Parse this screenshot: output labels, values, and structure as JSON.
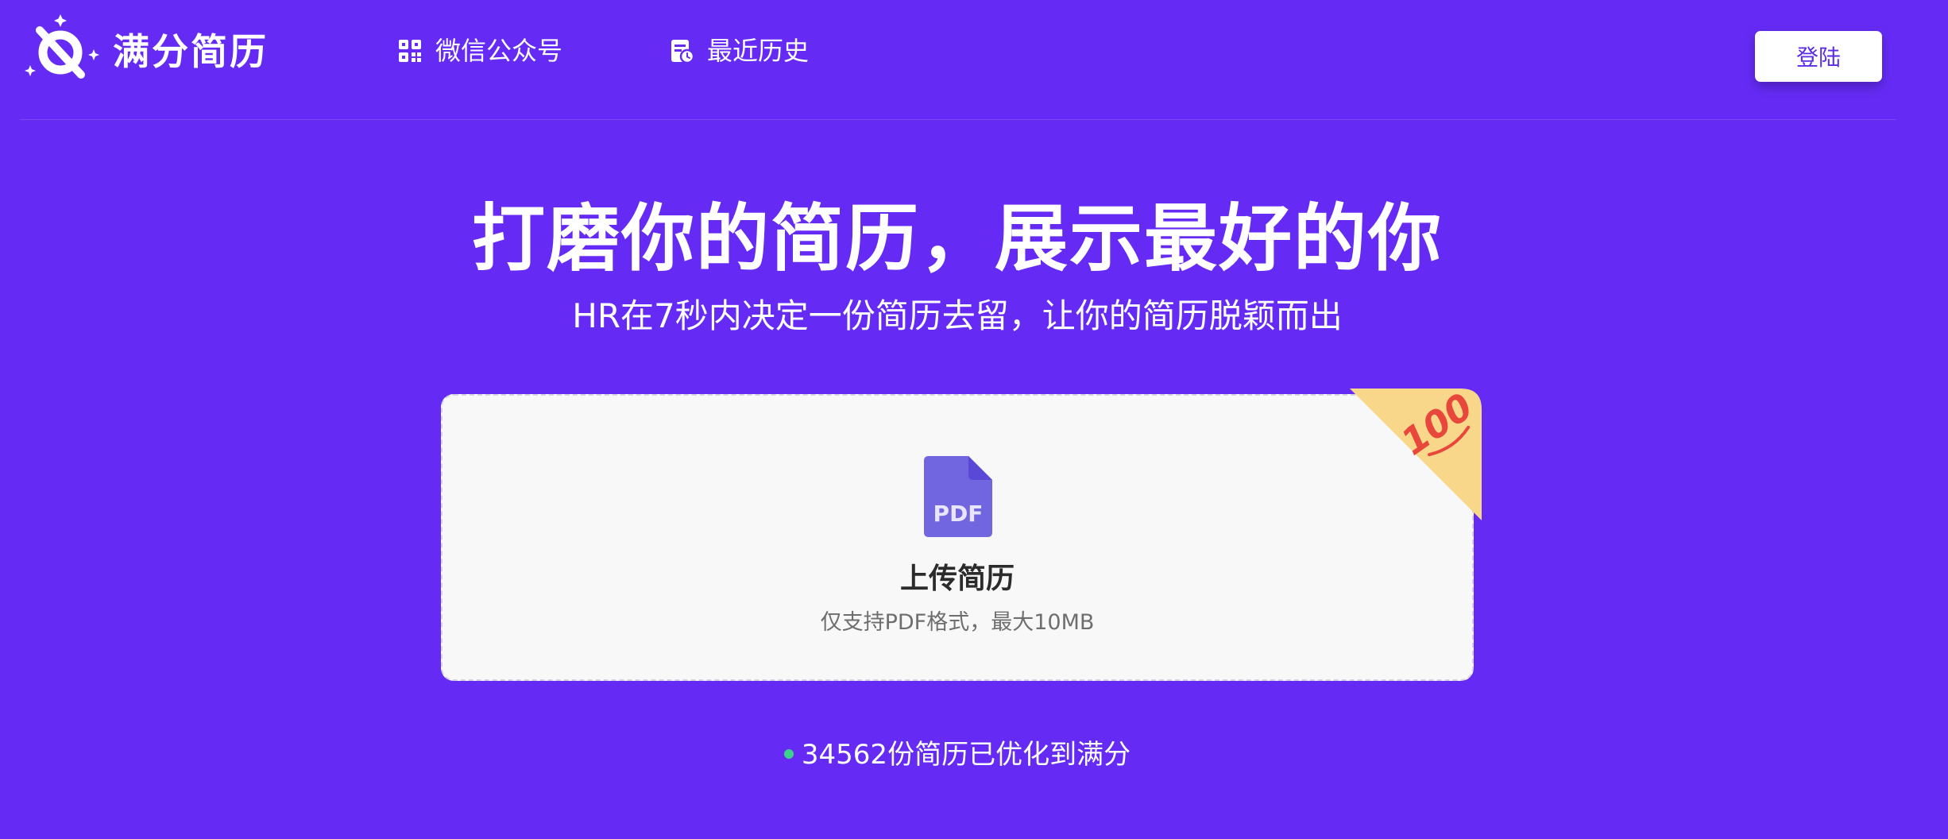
{
  "header": {
    "logo_text": "满分简历",
    "logo_icon": "scissors-sparkle-logo",
    "nav": [
      {
        "label": "微信公众号",
        "icon": "qrcode-icon"
      },
      {
        "label": "最近历史",
        "icon": "history-document-icon"
      }
    ],
    "login_label": "登陆"
  },
  "hero": {
    "title": "打磨你的简历，展示最好的你",
    "subtitle": "HR在7秒内决定一份简历去留，让你的简历脱颖而出"
  },
  "upload": {
    "file_icon_text": "PDF",
    "title": "上传简历",
    "hint": "仅支持PDF格式，最大10MB",
    "badge_text": "100"
  },
  "stats": {
    "text": "34562份简历已优化到满分"
  },
  "colors": {
    "background": "#652bf5",
    "accent": "#5b2be8",
    "pdf_icon": "#7266e0",
    "badge": "#f8d68a",
    "badge_text": "#e8473c",
    "status_dot": "#3dd28a"
  }
}
